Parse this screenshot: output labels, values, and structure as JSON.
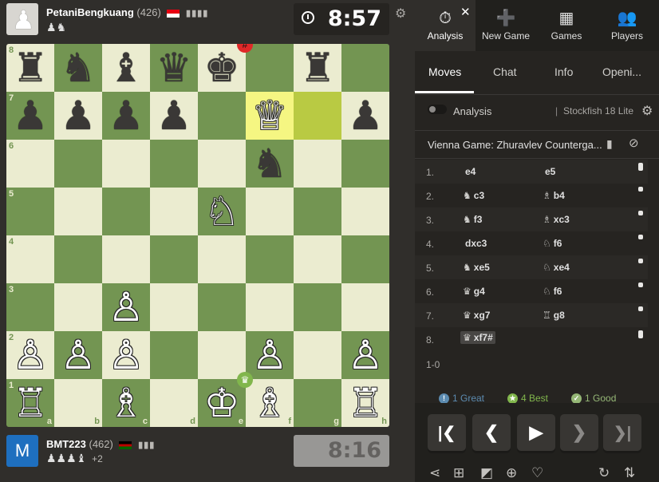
{
  "top_player": {
    "name": "PetaniBengkuang",
    "rating": "(426)",
    "avatar_glyph": "♟",
    "captured": "♟♞",
    "clock": "8:57",
    "flag_colors": [
      "#e70011",
      "#ffffff"
    ]
  },
  "bottom_player": {
    "name": "BMT223",
    "rating": "(462)",
    "avatar_initial": "M",
    "captured": "♟♟♟♝",
    "captured_extra": "+2",
    "clock": "8:16",
    "flag_colors": [
      "#000000",
      "#bb0000",
      "#006600"
    ]
  },
  "board": {
    "ranks": [
      [
        "♜",
        "♞",
        "♝",
        "♛",
        "♚",
        "",
        "♜",
        ""
      ],
      [
        "♟",
        "♟",
        "♟",
        "♟",
        "",
        "♕",
        "",
        "♟"
      ],
      [
        "",
        "",
        "",
        "",
        "",
        "♞",
        "",
        ""
      ],
      [
        "",
        "",
        "",
        "",
        "♘",
        "",
        "",
        ""
      ],
      [
        "",
        "",
        "",
        "",
        "",
        "",
        "",
        ""
      ],
      [
        "",
        "",
        "♙",
        "",
        "",
        "",
        "",
        ""
      ],
      [
        "♙",
        "♙",
        "♙",
        "",
        "",
        "♙",
        "",
        "♙"
      ],
      [
        "♖",
        "",
        "♗",
        "",
        "♔",
        "♗",
        "",
        "♖"
      ]
    ],
    "rank_labels": [
      "8",
      "7",
      "6",
      "5",
      "4",
      "3",
      "2",
      "1"
    ],
    "file_labels": [
      "a",
      "b",
      "c",
      "d",
      "e",
      "f",
      "g",
      "h"
    ],
    "highlight": [
      "f7",
      "g7"
    ],
    "mate_badge_square": "e8",
    "win_badge_square": "e1",
    "mate_badge_glyph": "#",
    "win_badge_glyph": "♛"
  },
  "nav": {
    "items": [
      {
        "label": "Analysis",
        "icon": "⏱"
      },
      {
        "label": "New Game",
        "icon": "➕"
      },
      {
        "label": "Games",
        "icon": "▦"
      },
      {
        "label": "Players",
        "icon": "👥"
      }
    ],
    "close_glyph": "✕"
  },
  "tabs": [
    "Moves",
    "Chat",
    "Info",
    "Openi..."
  ],
  "analysis": {
    "label": "Analysis",
    "engine": "Stockfish 18 Lite"
  },
  "opening": "Vienna Game: Zhuravlev Counterga...",
  "moves": [
    {
      "num": "1.",
      "white_fig": "",
      "white": "e4",
      "black_fig": "",
      "black": "e5"
    },
    {
      "num": "2.",
      "white_fig": "♞",
      "white": "c3",
      "black_fig": "♗",
      "black": "b4"
    },
    {
      "num": "3.",
      "white_fig": "♞",
      "white": "f3",
      "black_fig": "♗",
      "black": "xc3"
    },
    {
      "num": "4.",
      "white_fig": "",
      "white": "dxc3",
      "black_fig": "♘",
      "black": "f6"
    },
    {
      "num": "5.",
      "white_fig": "♞",
      "white": "xe5",
      "black_fig": "♘",
      "black": "xe4"
    },
    {
      "num": "6.",
      "white_fig": "♛",
      "white": "g4",
      "black_fig": "♘",
      "black": "f6"
    },
    {
      "num": "7.",
      "white_fig": "♛",
      "white": "xg7",
      "black_fig": "♖",
      "black": "g8"
    },
    {
      "num": "8.",
      "white_fig": "♛",
      "white": "xf7#",
      "black_fig": "",
      "black": ""
    }
  ],
  "result": "1-0",
  "summary": {
    "great": "1 Great",
    "best": "4 Best",
    "good": "1 Good",
    "great_color": "#5c8bb0",
    "best_color": "#81b64c",
    "good_color": "#95b776"
  },
  "controls": {
    "first": "⏮",
    "prev": "❮",
    "play": "▶",
    "next": "❯",
    "last": "⏭"
  }
}
